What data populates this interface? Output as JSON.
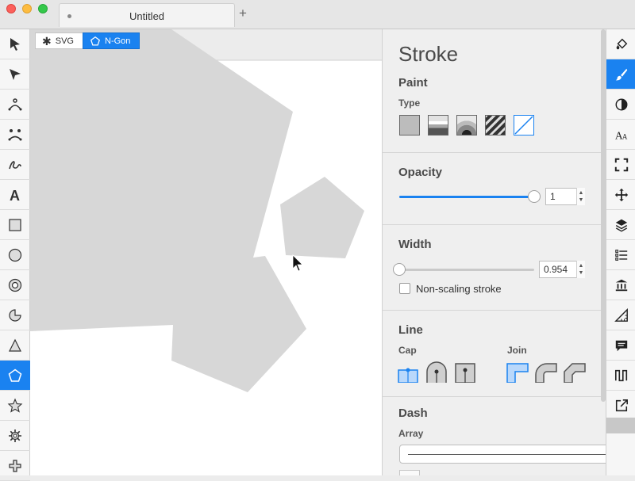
{
  "window": {
    "tab_title": "Untitled"
  },
  "breadcrumb": {
    "svg_label": "SVG",
    "ngon_label": "N-Gon"
  },
  "tools": [
    {
      "name": "select-tool",
      "icon": "arrow-icon"
    },
    {
      "name": "edit-tool",
      "icon": "node-arrow-icon"
    },
    {
      "name": "pen-tool",
      "icon": "pen-icon"
    },
    {
      "name": "triangle-path-tool",
      "icon": "triangle-path-icon"
    },
    {
      "name": "freehand-tool",
      "icon": "freehand-icon"
    },
    {
      "name": "text-tool",
      "icon": "text-icon"
    },
    {
      "name": "rectangle-tool",
      "icon": "rectangle-icon"
    },
    {
      "name": "ellipse-tool",
      "icon": "circle-icon"
    },
    {
      "name": "ring-tool",
      "icon": "ring-icon"
    },
    {
      "name": "pie-tool",
      "icon": "pie-icon"
    },
    {
      "name": "triangle-tool",
      "icon": "triangle-icon"
    },
    {
      "name": "ngon-tool",
      "icon": "pentagon-icon",
      "active": true
    },
    {
      "name": "star-tool",
      "icon": "star-icon"
    },
    {
      "name": "gear-tool",
      "icon": "gear-icon"
    },
    {
      "name": "cross-tool",
      "icon": "cross-icon"
    }
  ],
  "inspector": {
    "title": "Stroke",
    "paint": {
      "title": "Paint",
      "type_label": "Type"
    },
    "opacity": {
      "title": "Opacity",
      "value": "1",
      "slider": 1.0
    },
    "width": {
      "title": "Width",
      "value": "0.954",
      "slider": 0.0,
      "non_scaling_label": "Non-scaling stroke"
    },
    "line": {
      "title": "Line",
      "cap_label": "Cap",
      "join_label": "Join"
    },
    "dash": {
      "title": "Dash",
      "array_label": "Array"
    }
  },
  "right_tools": [
    {
      "name": "fill-panel",
      "icon": "paint-bucket-icon"
    },
    {
      "name": "stroke-panel",
      "icon": "brush-icon",
      "active": true
    },
    {
      "name": "compositing-panel",
      "icon": "contrast-icon"
    },
    {
      "name": "text-panel",
      "icon": "text-size-icon"
    },
    {
      "name": "viewport-panel",
      "icon": "frame-icon"
    },
    {
      "name": "transform-panel",
      "icon": "move-icon"
    },
    {
      "name": "layers-panel",
      "icon": "layers-icon"
    },
    {
      "name": "list-panel",
      "icon": "list-icon"
    },
    {
      "name": "library-panel",
      "icon": "library-icon"
    },
    {
      "name": "geometry-panel",
      "icon": "triangle-ruler-icon"
    },
    {
      "name": "comments-panel",
      "icon": "comment-icon"
    },
    {
      "name": "waveform-panel",
      "icon": "square-wave-icon"
    },
    {
      "name": "export-panel",
      "icon": "export-icon"
    }
  ],
  "colors": {
    "accent": "#1a82f0",
    "shape_fill": "#d7d7d7"
  }
}
